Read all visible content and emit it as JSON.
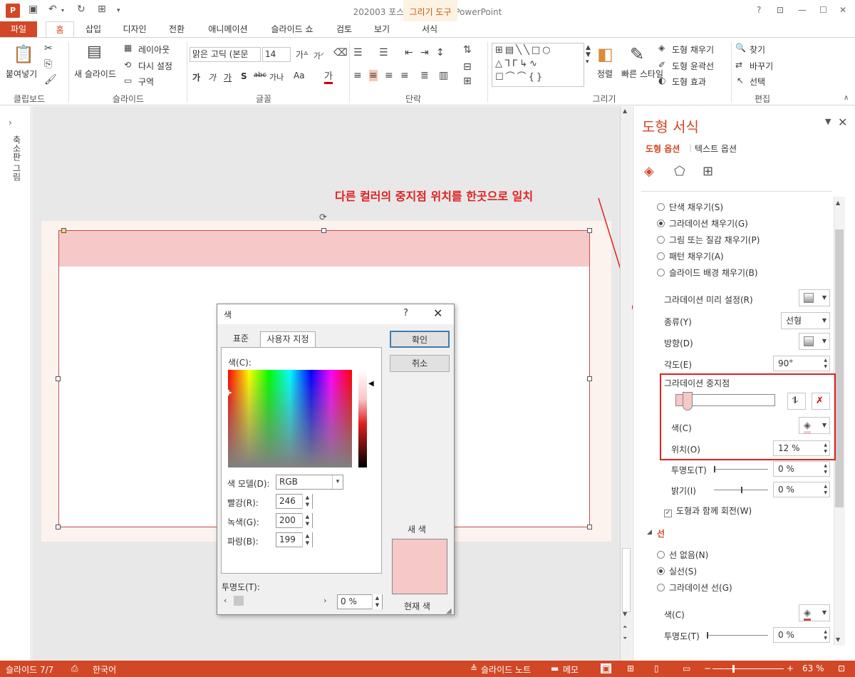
{
  "title_bar": {
    "document_title": "202003 포스팅용 완성본 - PowerPoint",
    "context_tab_group": "그리기 도구",
    "window_buttons": [
      "?",
      "⊡",
      "—",
      "☐",
      "✕"
    ]
  },
  "tabs": [
    "파일",
    "홈",
    "삽입",
    "디자인",
    "전환",
    "애니메이션",
    "슬라이드 쇼",
    "검토",
    "보기",
    "서식"
  ],
  "ribbon": {
    "clipboard": {
      "paste": "붙여넣기",
      "group": "클립보드"
    },
    "slides": {
      "new_slide": "새 슬라이드",
      "layout": "레이아웃",
      "reset": "다시 설정",
      "section": "구역",
      "group": "슬라이드"
    },
    "font": {
      "font_name": "맑은 고딕 (본문",
      "font_size": "14",
      "group": "글꼴",
      "bold": "가",
      "italic": "가",
      "underline": "가",
      "shadow": "S",
      "strike": "abc",
      "spacing": "가나",
      "case": "Aa"
    },
    "paragraph": {
      "group": "단락"
    },
    "drawing": {
      "arrange": "정렬",
      "quick_styles": "빠른 스타일",
      "shape_fill": "도형 채우기",
      "shape_outline": "도형 윤곽선",
      "shape_effects": "도형 효과",
      "group": "그리기"
    },
    "editing": {
      "find": "찾기",
      "replace": "바꾸기",
      "select": "선택",
      "group": "편집"
    }
  },
  "thumbnail_pane": {
    "label": "축소판 그림"
  },
  "annotation": "다른 컬러의 중지점 위치를 한곳으로 일치",
  "color_dialog": {
    "title": "색",
    "help": "?",
    "tab_standard": "표준",
    "tab_custom": "사용자 지정",
    "ok": "확인",
    "cancel": "취소",
    "colors_label": "색(C):",
    "color_model_label": "색 모델(D):",
    "color_model": "RGB",
    "red_label": "빨강(R):",
    "red": "246",
    "green_label": "녹색(G):",
    "green": "200",
    "blue_label": "파랑(B):",
    "blue": "199",
    "transparency_label": "투명도(T):",
    "transparency": "0 %",
    "new_label": "새 색",
    "current_label": "현재 색",
    "new_color": "#f6c8c7"
  },
  "format_pane": {
    "title": "도형 서식",
    "shape_options": "도형 옵션",
    "text_options": "텍스트 옵션",
    "fill_options": [
      {
        "label": "단색 채우기(S)",
        "selected": false
      },
      {
        "label": "그라데이션 채우기(G)",
        "selected": true
      },
      {
        "label": "그림 또는 질감 채우기(P)",
        "selected": false
      },
      {
        "label": "패턴 채우기(A)",
        "selected": false
      },
      {
        "label": "슬라이드 배경 채우기(B)",
        "selected": false
      }
    ],
    "preset_label": "그라데이션 미리 설정(R)",
    "type_label": "종류(Y)",
    "type_value": "선형",
    "direction_label": "방향(D)",
    "angle_label": "각도(E)",
    "angle_value": "90°",
    "stops_label": "그라데이션 중지점",
    "stop_color_label": "색(C)",
    "position_label": "위치(O)",
    "position_value": "12 %",
    "transparency_label": "투명도(T)",
    "transparency_value": "0 %",
    "brightness_label": "밝기(I)",
    "brightness_value": "0 %",
    "rotate_with_shape": "도형과 함께 회전(W)",
    "line_section": "선",
    "line_options": [
      {
        "label": "선 없음(N)",
        "selected": false
      },
      {
        "label": "실선(S)",
        "selected": true
      },
      {
        "label": "그라데이션 선(G)",
        "selected": false
      }
    ],
    "line_color_label": "색(C)",
    "line_transparency_label": "투명도(T)",
    "line_transparency_value": "0 %"
  },
  "status_bar": {
    "slide": "슬라이드 7/7",
    "language": "한국어",
    "notes": "슬라이드 노트",
    "comments": "메모",
    "zoom": "63 %"
  }
}
